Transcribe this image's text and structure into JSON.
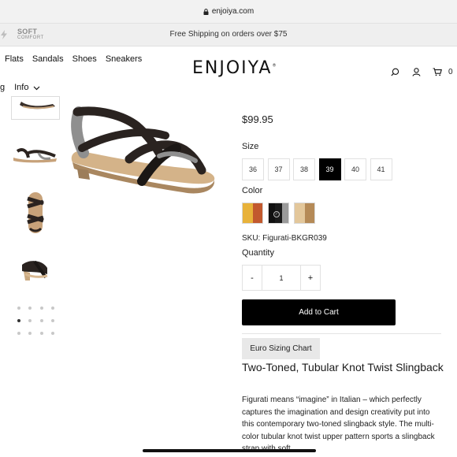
{
  "browser": {
    "url": "enjoiya.com"
  },
  "promo": {
    "logo_line1": "SOFT",
    "logo_line2": "COMFORT",
    "message": "Free Shipping on orders over $75"
  },
  "nav": {
    "items": [
      "Flats",
      "Sandals",
      "Shoes",
      "Sneakers"
    ],
    "row2_partial": "g",
    "info_label": "Info"
  },
  "brand": {
    "name": "ENJOIYA",
    "mark": "®"
  },
  "header_icons": {
    "search": "search-icon",
    "account": "user-icon",
    "cart": "cart-icon",
    "cart_count": "0"
  },
  "product": {
    "price": "$99.95",
    "size_label": "Size",
    "sizes": [
      "36",
      "37",
      "38",
      "39",
      "40",
      "41"
    ],
    "selected_size": "39",
    "color_label": "Color",
    "colors": [
      {
        "stripes": [
          "#e8b23a",
          "#c2592e"
        ]
      },
      {
        "stripes": [
          "#111111",
          "#1b1b1b",
          "#9a9a9a"
        ],
        "selected": true
      },
      {
        "stripes": [
          "#e3c79b",
          "#b58a57"
        ]
      }
    ],
    "sku": "SKU: Figurati-BKGR039",
    "quantity_label": "Quantity",
    "qty_minus": "-",
    "qty_value": "1",
    "qty_plus": "+",
    "add_to_cart": "Add to Cart",
    "euro_sizing": "Euro Sizing Chart",
    "title": "Two-Toned, Tubular Knot Twist Slingback",
    "description": "Figurati means “imagine” in Italian – which perfectly captures the imagination and design creativity put into this contemporary two-toned slingback style. The multi-color tubular knot twist upper pattern sports a slingback strap with soft"
  },
  "gallery": {
    "thumbnail_count": 4,
    "dot_rows": 3,
    "dot_cols": 4,
    "active_dot": 4
  }
}
